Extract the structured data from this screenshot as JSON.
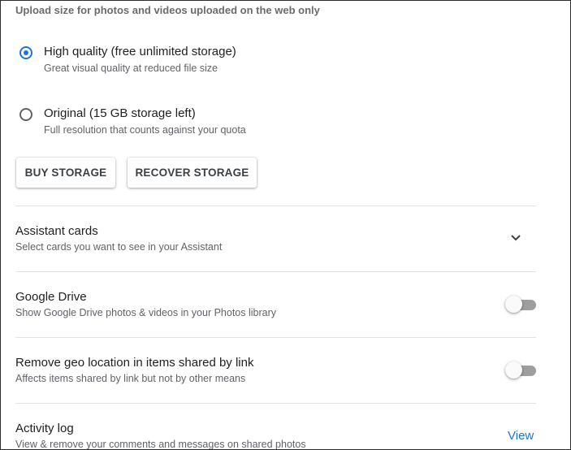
{
  "upload": {
    "header": "Upload size for photos and videos uploaded on the web only",
    "options": [
      {
        "title": "High quality (free unlimited storage)",
        "subtitle": "Great visual quality at reduced file size",
        "selected": true
      },
      {
        "title": "Original (15 GB storage left)",
        "subtitle": "Full resolution that counts against your quota",
        "selected": false
      }
    ],
    "buttons": {
      "buy": "BUY STORAGE",
      "recover": "RECOVER STORAGE"
    }
  },
  "settings": {
    "assistant_cards": {
      "title": "Assistant cards",
      "subtitle": "Select cards you want to see in your Assistant",
      "icon": "chevron-down-icon"
    },
    "google_drive": {
      "title": "Google Drive",
      "subtitle": "Show Google Drive photos & videos in your Photos library",
      "enabled": false
    },
    "remove_geo": {
      "title": "Remove geo location in items shared by link",
      "subtitle": "Affects items shared by link but not by other means",
      "enabled": false
    },
    "activity_log": {
      "title": "Activity log",
      "subtitle": "View & remove your comments and messages on shared photos",
      "link": "View"
    }
  },
  "colors": {
    "accent": "#1a73e8",
    "toggle_off_track": "#9e9e9e"
  }
}
